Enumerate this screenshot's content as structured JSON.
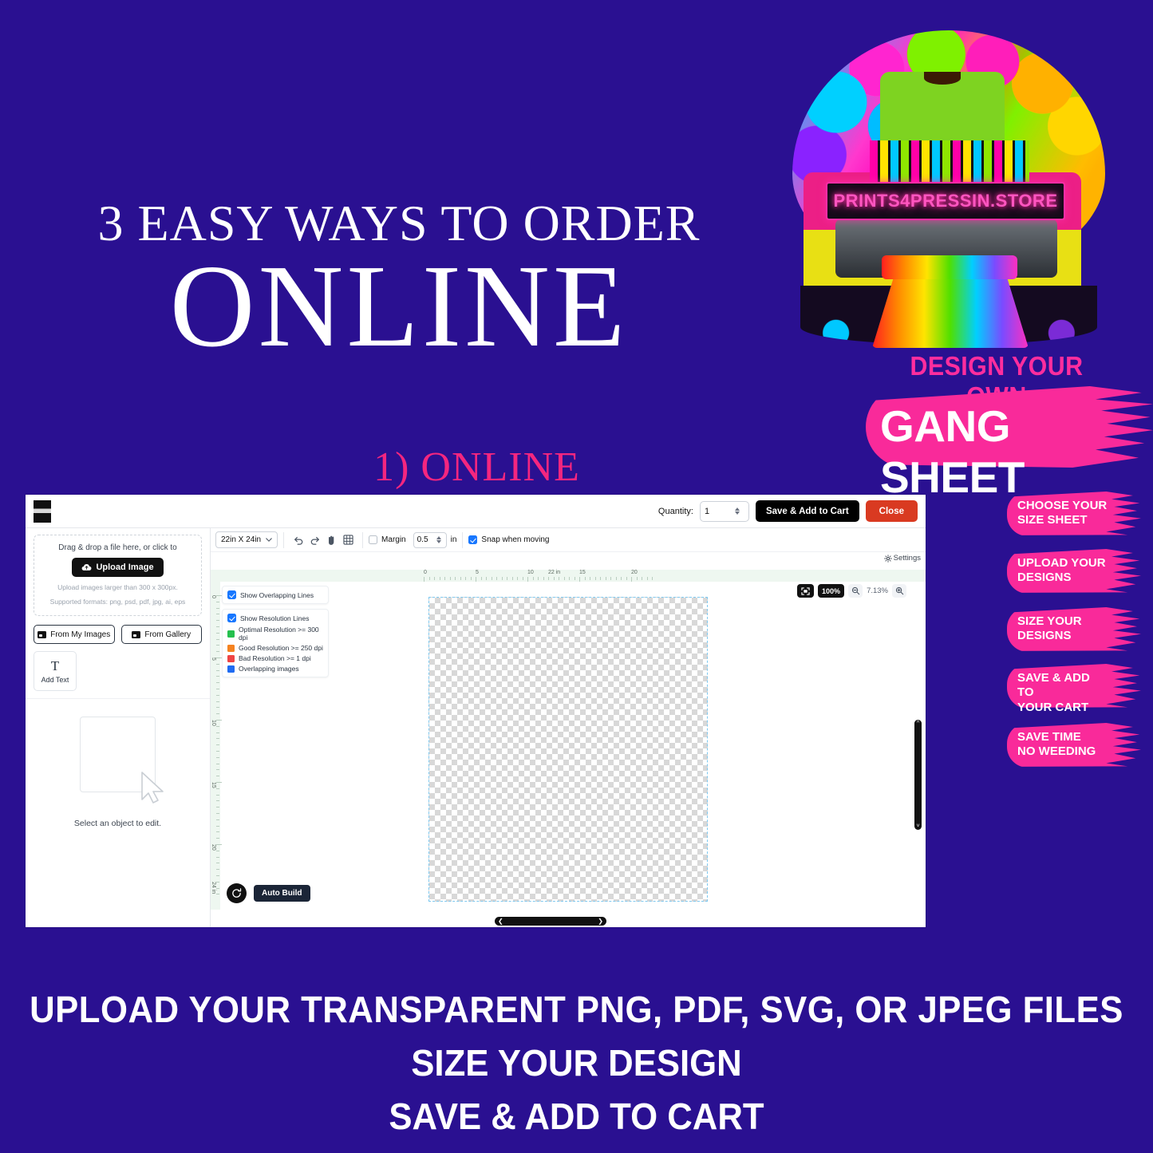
{
  "theme": {
    "background": "#2a1091",
    "pink": "#f4267f",
    "hot_pink": "#f92a9a",
    "white": "#ffffff",
    "accent_blue": "#1877ff",
    "red_button": "#d93a21"
  },
  "hero": {
    "line1": "3 EASY WAYS TO ORDER",
    "line2": "ONLINE",
    "step_label": "1) ONLINE"
  },
  "logo": {
    "banner_text": "PRINTS4PRESSIN.STORE",
    "icon_name": "printer-tshirt-logo"
  },
  "right_rail": {
    "design_your_own": "DESIGN YOUR OWN",
    "gang_sheet": "GANG SHEET",
    "chips": [
      {
        "line1": "CHOOSE YOUR",
        "line2": "SIZE SHEET"
      },
      {
        "line1": "UPLOAD YOUR",
        "line2": "DESIGNS"
      },
      {
        "line1": "SIZE YOUR",
        "line2": "DESIGNS"
      },
      {
        "line1": "SAVE & ADD TO",
        "line2": "YOUR  CART"
      },
      {
        "line1": "SAVE TIME",
        "line2": "NO WEEDING"
      }
    ]
  },
  "app": {
    "topbar": {
      "quantity_label": "Quantity:",
      "quantity_value": "1",
      "save_label": "Save & Add to Cart",
      "close_label": "Close"
    },
    "left_panel": {
      "drop_title": "Drag & drop a file here, or click to",
      "upload_label": "Upload Image",
      "note1": "Upload images larger than 300 x 300px.",
      "note2": "Supported formats: png, psd, pdf, jpg, ai, eps",
      "from_my_images": "From My Images",
      "from_gallery": "From Gallery",
      "add_text_glyph": "T",
      "add_text_label": "Add Text",
      "empty_state": "Select an object to edit."
    },
    "toolbar": {
      "sheet_size": "22in X 24in",
      "margin_label": "Margin",
      "margin_value": "0.5",
      "margin_unit": "in",
      "snap_label": "Snap when moving",
      "snap_checked": true,
      "margin_checked": false,
      "settings_label": "Settings",
      "undo_icon": "undo-icon",
      "redo_icon": "redo-icon",
      "hand_icon": "hand-tool-icon",
      "grid_icon": "grid-tool-icon"
    },
    "legend": {
      "show_overlapping": "Show Overlapping Lines",
      "show_overlapping_checked": true,
      "show_resolution": "Show Resolution Lines",
      "show_resolution_checked": true,
      "items": [
        {
          "label": "Optimal Resolution >= 300 dpi",
          "color": "#25c04e"
        },
        {
          "label": "Good Resolution >= 250 dpi",
          "color": "#f58220"
        },
        {
          "label": "Bad Resolution >= 1 dpi",
          "color": "#ef4444"
        },
        {
          "label": "Overlapping images",
          "color": "#1f6bf2"
        }
      ]
    },
    "rulers": {
      "horizontal_labels": [
        "0",
        "5",
        "10",
        "15",
        "20",
        "22 in"
      ],
      "vertical_labels": [
        "0",
        "5",
        "10",
        "15",
        "20",
        "24 in"
      ]
    },
    "zoom": {
      "fit_icon": "fit-to-screen-icon",
      "reset_label": "100%",
      "zoom_out_icon": "zoom-out-icon",
      "current": "7.13%",
      "zoom_in_icon": "zoom-in-icon"
    },
    "footer": {
      "refresh_icon": "refresh-icon",
      "auto_build": "Auto Build"
    }
  },
  "bottom_copy": {
    "line1": "UPLOAD YOUR TRANSPARENT PNG, PDF, SVG, OR JPEG FILES",
    "line2": "SIZE YOUR DESIGN",
    "line3": "SAVE & ADD TO CART"
  }
}
